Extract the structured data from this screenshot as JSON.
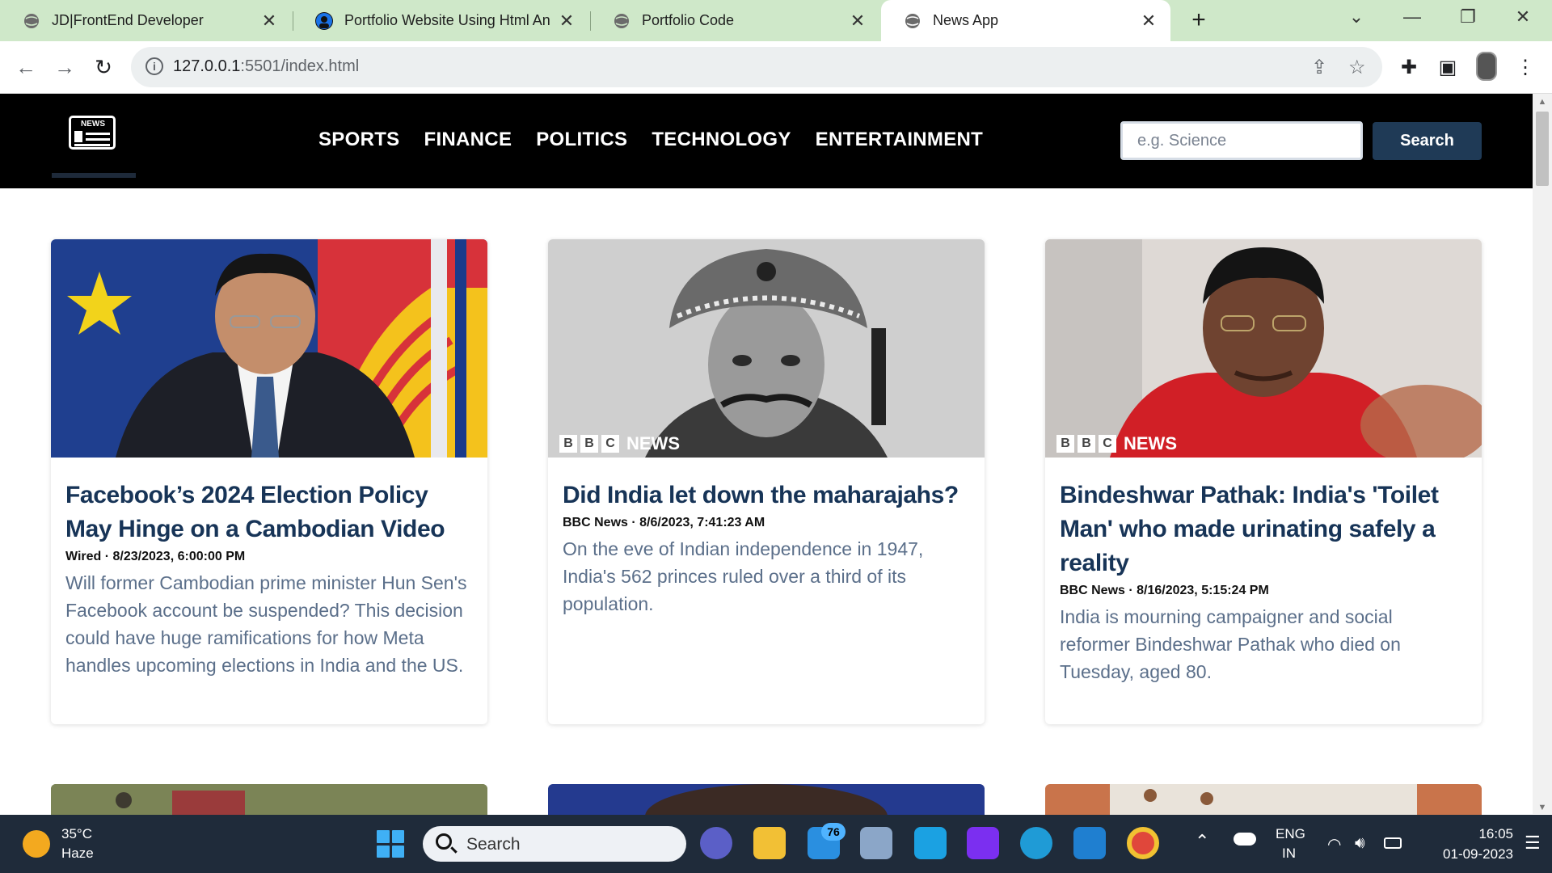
{
  "browser": {
    "tabs": [
      {
        "title": "JD|FrontEnd Developer",
        "active": false
      },
      {
        "title": "Portfolio Website Using Html An",
        "active": false
      },
      {
        "title": "Portfolio Code",
        "active": false
      },
      {
        "title": "News App",
        "active": true
      }
    ],
    "url_host": "127.0.0.1",
    "url_rest": ":5501/index.html"
  },
  "nav": {
    "links": [
      "SPORTS",
      "FINANCE",
      "POLITICS",
      "TECHNOLOGY",
      "ENTERTAINMENT"
    ],
    "logo_text": "NEWS",
    "search_placeholder": "e.g. Science",
    "search_label": "Search"
  },
  "articles": [
    {
      "title": "Facebook’s 2024 Election Policy May Hinge on a Cambodian Video",
      "meta": "Wired · 8/23/2023, 6:00:00 PM",
      "description": "Will former Cambodian prime minister Hun Sen's Facebook account be suspended? This decision could have huge ramifications for how Meta handles upcoming elections in India and the US."
    },
    {
      "title": "Did India let down the maharajahs?",
      "meta": "BBC News · 8/6/2023, 7:41:23 AM",
      "description": "On the eve of Indian independence in 1947, India's 562 princes ruled over a third of its population.",
      "image_brand": "NEWS"
    },
    {
      "title": "Bindeshwar Pathak: India's 'Toilet Man' who made urinating safely a reality",
      "meta": "BBC News · 8/16/2023, 5:15:24 PM",
      "description": "India is mourning campaigner and social reformer Bindeshwar Pathak who died on Tuesday, aged 80.",
      "image_brand": "NEWS"
    }
  ],
  "bbc_letters": [
    "B",
    "B",
    "C"
  ],
  "taskbar": {
    "weather_temp": "35°C",
    "weather_condition": "Haze",
    "search_label": "Search",
    "mail_badge": "76",
    "lang_line1": "ENG",
    "lang_line2": "IN",
    "time": "16:05",
    "date": "01-09-2023"
  },
  "colors": {
    "nav_bg": "#000000",
    "headline": "#173457",
    "description": "#5b6f8a",
    "search_button": "#1f3a56",
    "tabstrip": "#cfe8c9"
  }
}
